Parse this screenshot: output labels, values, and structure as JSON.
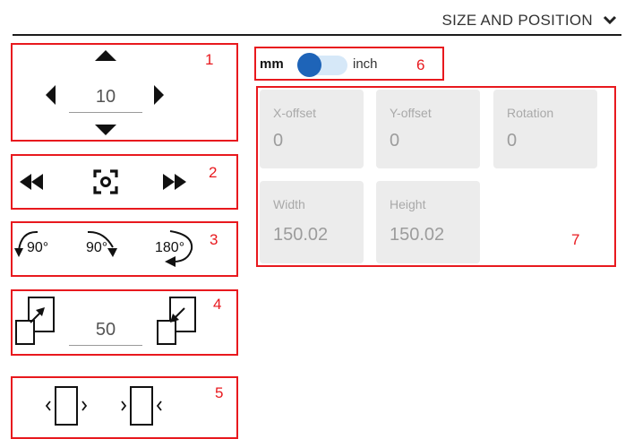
{
  "header": {
    "title": "SIZE AND POSITION",
    "chevron_icon": "chevron-down-icon"
  },
  "annotations": [
    "1",
    "2",
    "3",
    "4",
    "5",
    "6",
    "7"
  ],
  "move_panel": {
    "value": "10",
    "icons": [
      "arrow-up-icon",
      "arrow-left-icon",
      "arrow-right-icon",
      "arrow-down-icon"
    ]
  },
  "center_panel": {
    "icons": [
      "fast-rewind-icon",
      "center-focus-icon",
      "fast-forward-icon"
    ]
  },
  "rotate_panel": {
    "rotate_ccw_90_label": "90°",
    "rotate_cw_90_label": "90°",
    "rotate_180_label": "180°"
  },
  "scale_panel": {
    "value": "50",
    "icons": [
      "scale-up-icon",
      "scale-down-icon"
    ]
  },
  "flip_panel": {
    "icons": [
      "flip-horizontal-out-icon",
      "flip-horizontal-in-icon"
    ]
  },
  "units": {
    "metric": "mm",
    "imperial": "inch",
    "selected": "mm"
  },
  "fields": {
    "x_offset": {
      "label": "X-offset",
      "value": "0"
    },
    "y_offset": {
      "label": "Y-offset",
      "value": "0"
    },
    "rotation": {
      "label": "Rotation",
      "value": "0"
    },
    "width": {
      "label": "Width",
      "value": "150.02"
    },
    "height": {
      "label": "Height",
      "value": "150.02"
    }
  },
  "colors": {
    "annotation": "#e8191e",
    "toggle_knob": "#1e64b8",
    "toggle_track": "#d6e8f8",
    "field_bg": "#ececec"
  }
}
